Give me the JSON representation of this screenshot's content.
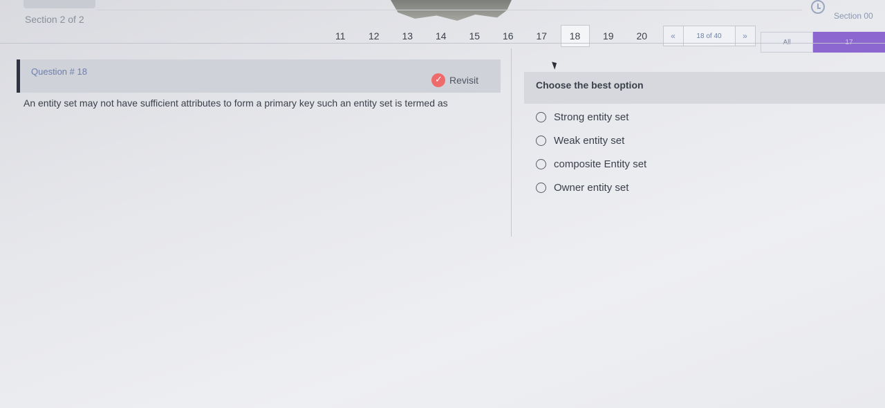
{
  "header": {
    "section_label": "Section 2 of 2",
    "section_right": "Section 00"
  },
  "pager": {
    "pages": [
      "11",
      "12",
      "13",
      "14",
      "15",
      "16",
      "17",
      "18",
      "19",
      "20"
    ],
    "active": "18",
    "prev_label": "«",
    "next_label": "»",
    "count_label": "18 of 40"
  },
  "filter": {
    "all_label": "All",
    "count_badge": "17"
  },
  "question": {
    "title": "Question # 18",
    "revisit_label": "Revisit",
    "text": "An entity set may not have sufficient attributes to form a primary key such an entity set is termed as"
  },
  "answers": {
    "prompt": "Choose the best option",
    "options": [
      "Strong entity set",
      "Weak entity set",
      "composite Entity set",
      "Owner entity set"
    ]
  },
  "icons": {
    "clock": "clock-icon",
    "revisit": "revisit-check-icon",
    "cursor": "mouse-pointer-icon"
  },
  "colors": {
    "accent_purple": "#8b67cf",
    "revisit_red": "#ef6a6a",
    "question_bar": "#2f3440"
  }
}
